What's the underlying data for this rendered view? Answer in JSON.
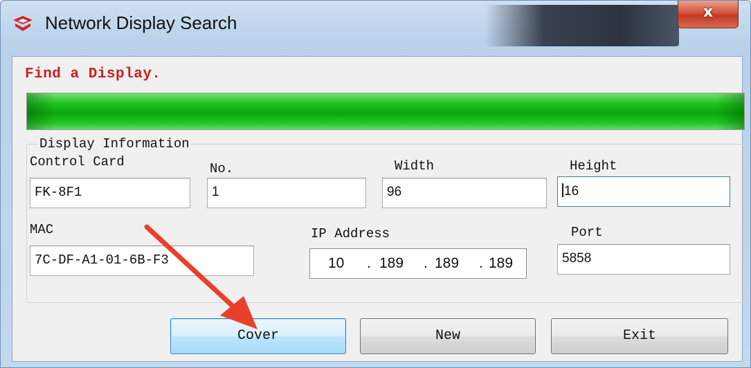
{
  "window": {
    "title": "Network Display Search",
    "close_label": "x"
  },
  "status": {
    "message": "Find a Display.",
    "progress_percent": 100,
    "progress_color": "#13b513"
  },
  "group": {
    "title": "Display Information"
  },
  "fields": {
    "control_card": {
      "label": "Control Card",
      "value": "FK-8F1"
    },
    "no": {
      "label": "No.",
      "value": "1"
    },
    "width": {
      "label": "Width",
      "value": "96"
    },
    "height": {
      "label": "Height",
      "value": "16"
    },
    "mac": {
      "label": "MAC",
      "value": "7C-DF-A1-01-6B-F3"
    },
    "ip_address": {
      "label": "IP Address",
      "octets": [
        "10",
        "189",
        "189",
        "189"
      ],
      "separator": "."
    },
    "port": {
      "label": "Port",
      "value": "5858"
    }
  },
  "buttons": {
    "cover": "Cover",
    "new": "New",
    "exit": "Exit"
  },
  "annotation": {
    "arrow_color": "#e8402a",
    "points_to": "cover-button"
  },
  "icons": {
    "app": "app-logo-icon",
    "close": "close-icon",
    "annotation": "red-arrow-icon"
  }
}
